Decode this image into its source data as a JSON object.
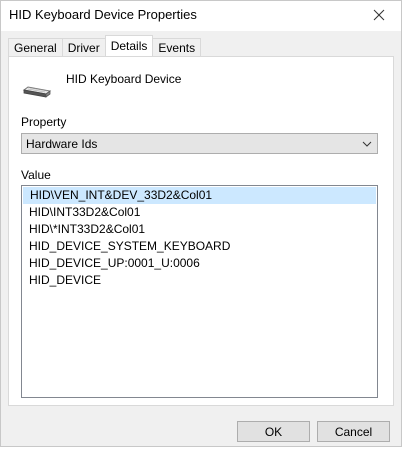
{
  "window": {
    "title": "HID Keyboard Device Properties"
  },
  "tabs": [
    {
      "label": "General"
    },
    {
      "label": "Driver"
    },
    {
      "label": "Details",
      "active": true
    },
    {
      "label": "Events"
    }
  ],
  "details": {
    "device_name": "HID Keyboard Device",
    "device_icon": "keyboard-icon",
    "property_label": "Property",
    "property_selected": "Hardware Ids",
    "value_label": "Value",
    "values": [
      "HID\\VEN_INT&DEV_33D2&Col01",
      "HID\\INT33D2&Col01",
      "HID\\*INT33D2&Col01",
      "HID_DEVICE_SYSTEM_KEYBOARD",
      "HID_DEVICE_UP:0001_U:0006",
      "HID_DEVICE"
    ],
    "selected_value_index": 0
  },
  "buttons": {
    "ok_label": "OK",
    "cancel_label": "Cancel"
  },
  "colors": {
    "selection": "#cce8ff",
    "window_bg": "#f0f0f0",
    "button_bg": "#e1e1e1"
  }
}
